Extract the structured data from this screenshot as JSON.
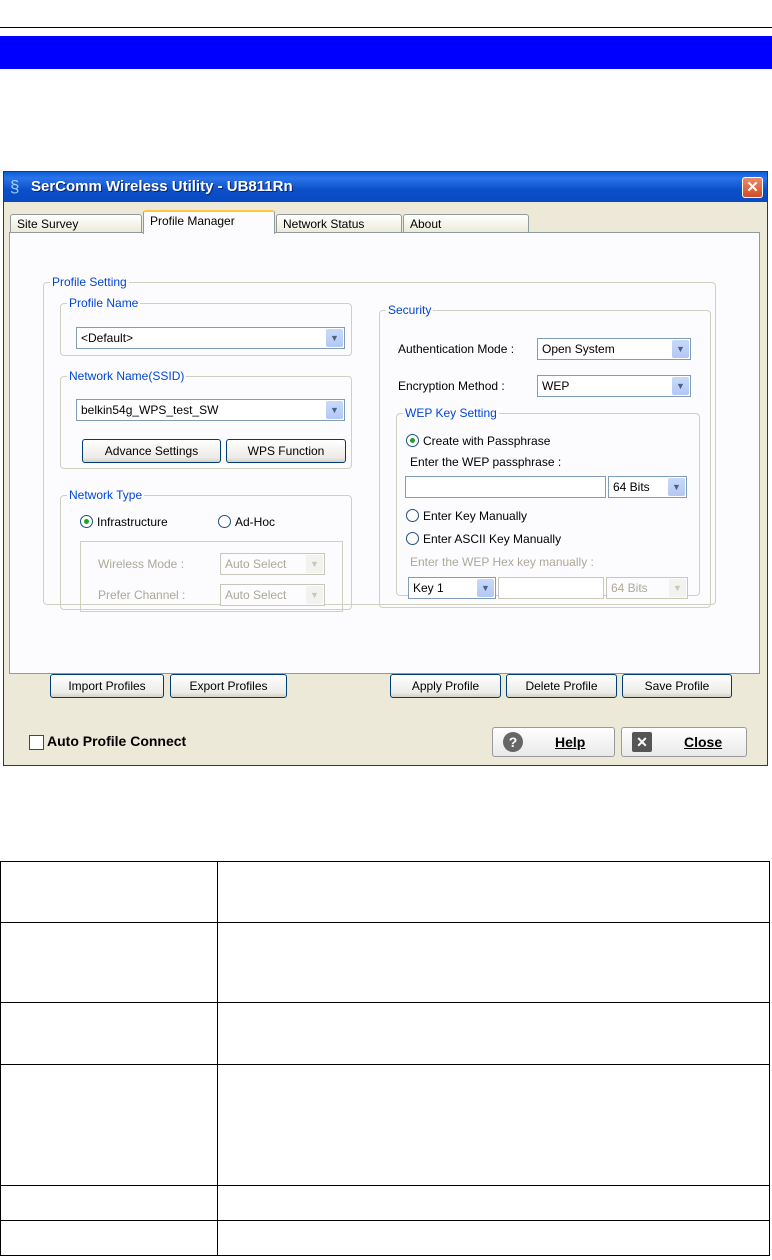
{
  "window": {
    "title": "SerComm Wireless Utility - UB811Rn",
    "close_glyph": "✕"
  },
  "tabs": [
    {
      "label": "Site Survey"
    },
    {
      "label": "Profile Manager"
    },
    {
      "label": "Network Status"
    },
    {
      "label": "About"
    }
  ],
  "profile_setting": {
    "legend": "Profile Setting",
    "profile_name": {
      "legend": "Profile Name",
      "value": "<Default>"
    },
    "ssid": {
      "legend": "Network Name(SSID)",
      "value": "belkin54g_WPS_test_SW"
    },
    "advance_settings": "Advance Settings",
    "wps_function": "WPS Function",
    "network_type": {
      "legend": "Network Type",
      "infrastructure": "Infrastructure",
      "adhoc": "Ad-Hoc",
      "wireless_mode_label": "Wireless Mode :",
      "wireless_mode_value": "Auto Select",
      "prefer_channel_label": "Prefer Channel :",
      "prefer_channel_value": "Auto Select"
    },
    "security": {
      "legend": "Security",
      "auth_label": "Authentication Mode :",
      "auth_value": "Open System",
      "enc_label": "Encryption Method :",
      "enc_value": "WEP",
      "wep": {
        "legend": "WEP Key Setting",
        "create_passphrase": "Create with Passphrase",
        "enter_passphrase_label": "Enter the WEP passphrase :",
        "bits_value": "64 Bits",
        "enter_manually": "Enter Key Manually",
        "enter_ascii": "Enter ASCII Key Manually",
        "hex_label": "Enter the WEP Hex key manually :",
        "key_value": "Key 1",
        "hex_bits_value": "64 Bits"
      }
    }
  },
  "buttons": {
    "import": "Import Profiles",
    "export": "Export Profiles",
    "apply": "Apply  Profile",
    "delete": "Delete Profile",
    "save": "Save Profile"
  },
  "footer": {
    "auto_connect": "Auto Profile Connect",
    "help": "Help",
    "close": "Close",
    "help_glyph": "?",
    "close_glyph": "✕"
  },
  "table": {
    "rows": [
      {
        "c1": "",
        "c2": ""
      },
      {
        "c1": "",
        "c2": ""
      },
      {
        "c1": "",
        "c2": ""
      },
      {
        "c1": "",
        "c2": ""
      },
      {
        "c1": "",
        "c2": ""
      },
      {
        "c1": "",
        "c2": ""
      }
    ]
  }
}
